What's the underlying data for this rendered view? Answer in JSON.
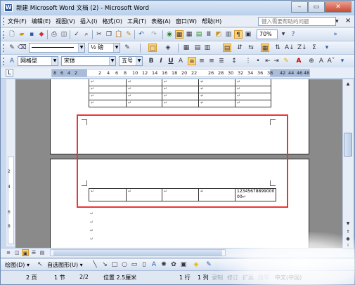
{
  "window": {
    "title": "新建 Microsoft Word 文档 (2) - Microsoft Word",
    "app_icon": "word-icon"
  },
  "menu": {
    "items": [
      "文件(F)",
      "编辑(E)",
      "视图(V)",
      "插入(I)",
      "格式(O)",
      "工具(T)",
      "表格(A)",
      "窗口(W)",
      "帮助(H)"
    ],
    "help_placeholder": "键入需要帮助的问题"
  },
  "toolbar": {
    "zoom": "70%",
    "font_size_scale": "½ 磅",
    "style": "网格型",
    "font": "宋体",
    "size": "五号"
  },
  "ruler": {
    "numbers": [
      "8",
      "6",
      "4",
      "2",
      "2",
      "4",
      "6",
      "8",
      "10",
      "12",
      "14",
      "16",
      "18",
      "20",
      "22",
      "26",
      "28",
      "30",
      "32",
      "34",
      "36",
      "38",
      "42",
      "44",
      "46",
      "48"
    ]
  },
  "vruler": {
    "numbers": [
      "2",
      "4",
      "6",
      "8"
    ]
  },
  "document": {
    "cell_mark": "↵",
    "last_cell_text": "12345678899000",
    "last_cell_text2": "00↵"
  },
  "drawing_toolbar": {
    "draw_label": "绘图(D) ▾",
    "autoshape_label": "自选图形(U) ▾"
  },
  "status": {
    "page": "2 页",
    "section": "1 节",
    "pages": "2/2",
    "position": "位置 2.5厘米",
    "line": "1 行",
    "col": "1 列",
    "rec": "录制",
    "trk": "修订",
    "ext": "扩展",
    "ovr": "改写",
    "language": "中文(中国)"
  }
}
